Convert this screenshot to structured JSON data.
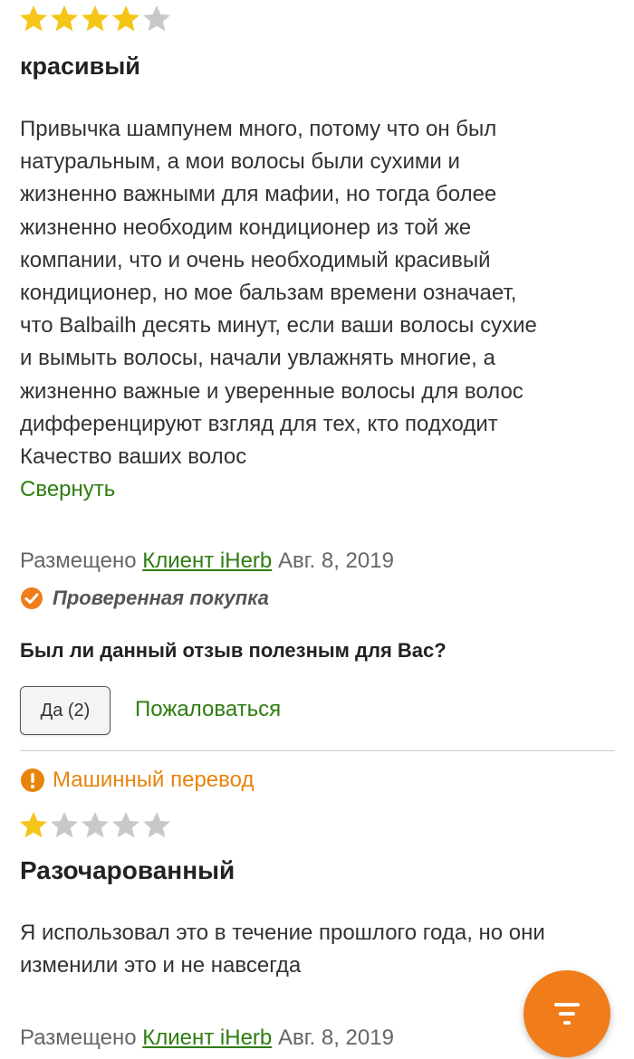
{
  "reviews": [
    {
      "rating": 4,
      "max_rating": 5,
      "title": "красивый",
      "text": "Привычка шампунем много, потому что он был\nнатуральным, а мои волосы были сухими и\nжизненно важными для мафии, но тогда более\nжизненно необходим кондиционер из той же\nкомпании, что и очень необходимый красивый\nкондиционер, но мое бальзам времени означает,\nчто Balbailh десять минут, если ваши волосы сухие\nи вымыть волосы, начали увлажнять многие, а\nжизненно важные и уверенные волосы для волос\nдифференцируют взгляд для тех, кто подходит\nКачество ваших волос",
      "collapse_label": "Свернуть",
      "posted_prefix": "Размещено",
      "author": "Клиент iHerb",
      "date": "Авг. 8, 2019",
      "verified_label": "Проверенная покупка",
      "helpful_question": "Был ли данный отзыв полезным для Вас?",
      "yes_label": "Да (2)",
      "report_label": "Пожаловаться"
    },
    {
      "machine_translation_label": "Машинный перевод",
      "rating": 1,
      "max_rating": 5,
      "title": "Разочарованный",
      "text": "Я использовал это в течение прошлого года, но они\nизменили это и не навсегда",
      "posted_prefix": "Размещено",
      "author": "Клиент iHerb",
      "date": "Авг. 8, 2019"
    }
  ],
  "colors": {
    "star_filled": "#f5c518",
    "star_empty": "#c8c8c8",
    "link": "#2e7d0f",
    "accent": "#f07c1a",
    "warning": "#e8830c"
  },
  "icons": {
    "star": "star-icon",
    "verified": "check-circle-icon",
    "warning": "exclamation-circle-icon",
    "filter": "filter-icon"
  }
}
